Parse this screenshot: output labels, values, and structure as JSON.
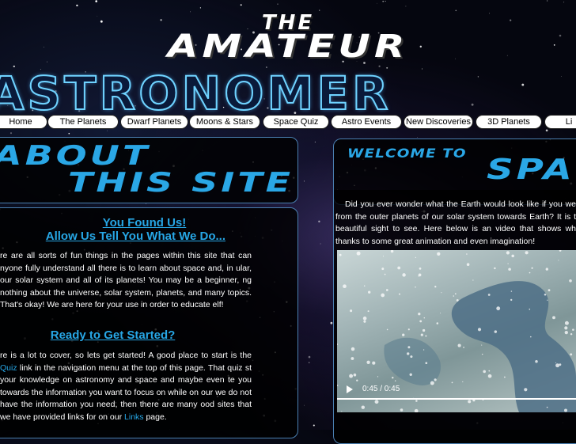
{
  "header": {
    "the": "THE",
    "amateur": "AMATEUR",
    "astronomer": "ASTRONOMER"
  },
  "nav": {
    "items": [
      {
        "label": "Home"
      },
      {
        "label": "The Planets"
      },
      {
        "label": "Dwarf Planets"
      },
      {
        "label": "Moons & Stars"
      },
      {
        "label": "Space Quiz"
      },
      {
        "label": "Astro Events"
      },
      {
        "label": "New Discoveries"
      },
      {
        "label": "3D Planets"
      },
      {
        "label": "Li"
      }
    ]
  },
  "about": {
    "title_line1": "ABOUT",
    "title_line2": "THIS SITE",
    "heading1_line1": "You Found Us!",
    "heading1_line2": "Allow Us Tell You What We Do...",
    "para1": "re are all sorts of fun things in the pages within this site that can nyone fully understand all there is to learn about space and, in ular, our solar system and all of its planets! You may be a beginner, ng nothing about the universe, solar system, planets, and many topics. That's okay! We are here for your use in order to educate elf!",
    "heading2": "Ready to Get Started?",
    "para2_a": "re is a lot to cover, so lets get started! A good place to start is the ",
    "para2_quiz": "Quiz",
    "para2_b": " link in the navigation menu at the top of this page. That quiz st your knowledge on astronomy and space and maybe even te you towards the information you want to focus on while on our we do not have the information you need, then there are many ood sites that we have provided links for on our ",
    "para2_links": "Links",
    "para2_c": " page."
  },
  "welcome": {
    "title_line1": "WELCOME TO",
    "title_line2": "SPA",
    "para": "Did you ever wonder what the Earth would look like if you we from the outer planets of our solar system towards Earth? It is t beautiful sight to see. Here below is an video that shows wh thanks to some great animation and even imagination!",
    "video_time": "0:45 / 0:45",
    "video_progress": 1.0
  }
}
